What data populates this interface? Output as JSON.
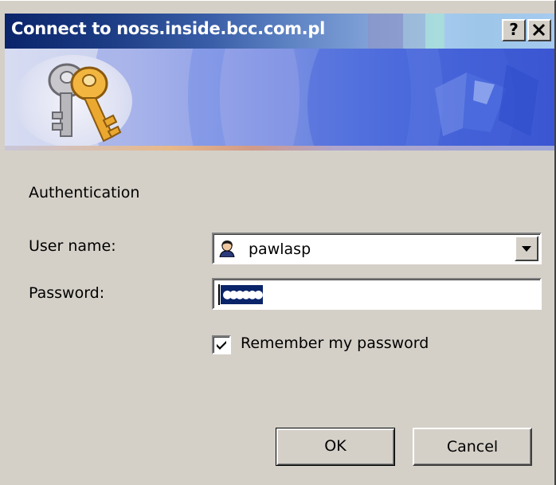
{
  "window": {
    "title": "Connect to noss.inside.bcc.com.pl",
    "help_label": "?",
    "close_label": "✕"
  },
  "banner": {
    "icon": "keys-icon"
  },
  "form": {
    "section_label": "Authentication",
    "username_label": "User name:",
    "username_value": "pawlasp",
    "username_icon": "user-icon",
    "password_label": "Password:",
    "password_mask": "●●●●●●",
    "remember_label": "Remember my password",
    "remember_checked": true
  },
  "buttons": {
    "ok_label": "OK",
    "cancel_label": "Cancel"
  },
  "colors": {
    "titlebar_start": "#0a246a",
    "titlebar_end": "#a6caf0",
    "dialog_background": "#d4d0c8",
    "selection": "#0a246a"
  }
}
